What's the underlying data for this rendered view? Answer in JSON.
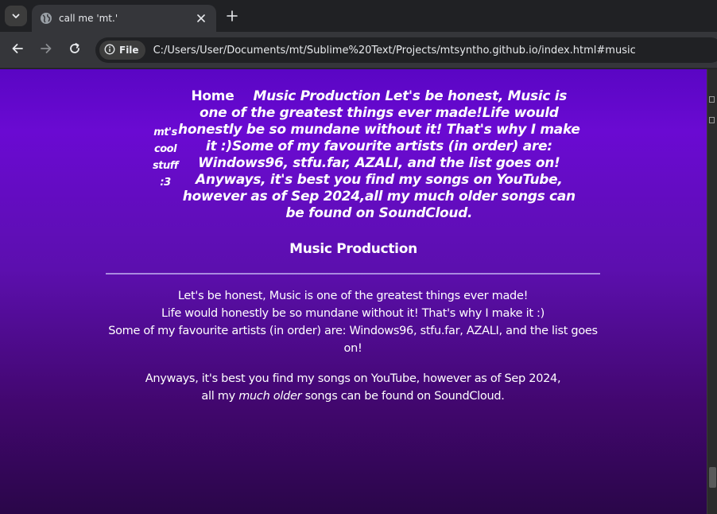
{
  "browser": {
    "tab_title": "call me 'mt.'",
    "site_chip_label": "File",
    "url": "C:/Users/User/Documents/mt/Sublime%20Text/Projects/mtsyntho.github.io/index.html#music"
  },
  "header": {
    "home_label": "Home",
    "side_lines": [
      "mt's",
      "cool",
      "stuff",
      ":3"
    ],
    "lines": [
      "Music Production Let's be honest, Music is",
      "one of the greatest things ever made!Life would",
      "honestly be so mundane without it! That's why I make",
      "it :)Some of my favourite artists (in order) are:",
      "Windows96, stfu.far, AZALI, and the list goes on!",
      "Anyways, it's best you find my songs on YouTube,",
      "however as of Sep 2024,all my much older songs can",
      "be found on SoundCloud."
    ]
  },
  "section": {
    "title": "Music Production",
    "para1": [
      "Let's be honest, Music is one of the greatest things ever made!",
      "Life would honestly be so mundane without it! That's why I make it :)",
      "Some of my favourite artists (in order) are: Windows96, stfu.far, AZALI, and the list goes",
      "on!"
    ],
    "para2_line1": "Anyways, it's best you find my songs on YouTube, however as of Sep 2024,",
    "para2_line2_start": "all my ",
    "para2_emphasis": "much older",
    "para2_line2_end": " songs can be found on SoundCloud."
  }
}
